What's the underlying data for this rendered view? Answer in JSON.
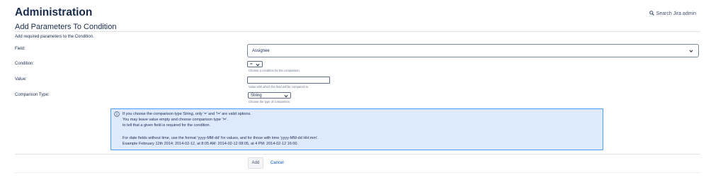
{
  "header": {
    "title": "Administration",
    "search_label": "Search Jira admin",
    "search_icon": "search-icon"
  },
  "form": {
    "section_title": "Add Parameters To Condition",
    "intro": "Add required parameters to the Condition.",
    "field": {
      "label": "Field:",
      "selected": "Assignee"
    },
    "condition": {
      "label": "Condition:",
      "selected": "=",
      "help": "Choose a condition for the comparison."
    },
    "value": {
      "label": "Value:",
      "current": "",
      "help": "Value with which the field will be compared to."
    },
    "comparison_type": {
      "label": "Comparison Type:",
      "selected": "String",
      "help": "Choose the type of comparison."
    }
  },
  "info": {
    "icon": "info-icon",
    "line1": "If you choose the comparison type String, only '=' and '!=' are valid options.",
    "line2": "You may leave value empty and choose comparison type '!='.",
    "line3": "to tell that a given field is required for the condition.",
    "line4": "For date fields without time, use the format 'yyyy-MM-dd' for values, and for those with time 'yyyy-MM-dd HH:mm'.",
    "line5": "Example February 12th 2014: 2014-02-12, at 8:05 AM: 2014-02-12 08:05, at 4 PM: 2014-02-12 16:00."
  },
  "actions": {
    "add_label": "Add",
    "cancel_label": "Cancel"
  },
  "colors": {
    "info_border": "#4c9aff",
    "info_background": "#deebff",
    "link": "#0052cc"
  }
}
